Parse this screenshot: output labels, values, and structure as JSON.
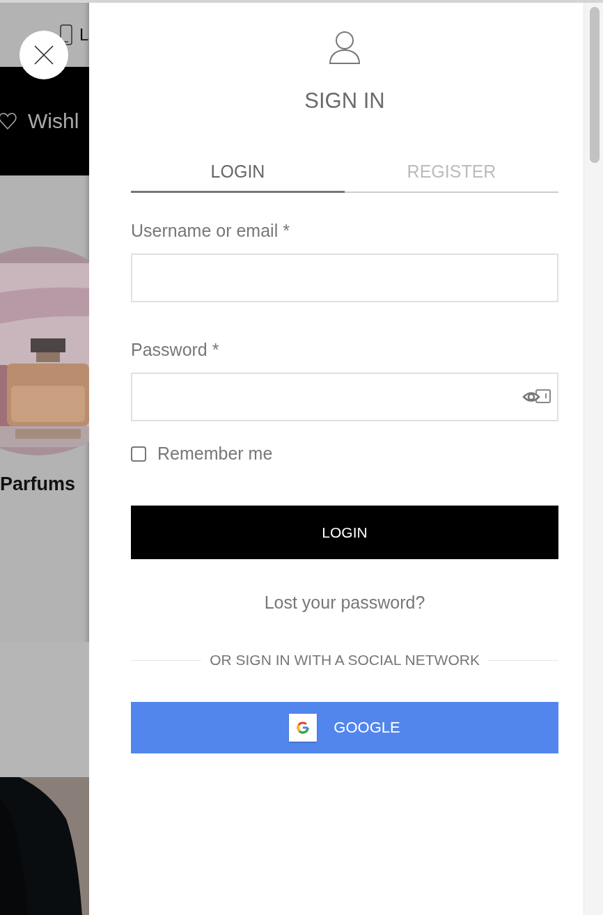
{
  "background_page": {
    "top_bar_text": "L",
    "wishlist_label": "Wishl",
    "category_label": "Parfums"
  },
  "sign_in": {
    "title": "SIGN IN",
    "tabs": [
      {
        "label": "LOGIN",
        "selected": true
      },
      {
        "label": "REGISTER",
        "selected": false
      }
    ],
    "fields": [
      {
        "label": "Username or email *",
        "kind": "text"
      },
      {
        "label": "Password *",
        "kind": "password"
      }
    ],
    "remember": {
      "label": "Remember me",
      "checked": false
    },
    "login_button": "LOGIN",
    "lost_password": "Lost your password?",
    "divider": "OR SIGN IN WITH A SOCIAL NETWORK",
    "social_buttons": [
      {
        "label": "GOOGLE"
      }
    ]
  }
}
